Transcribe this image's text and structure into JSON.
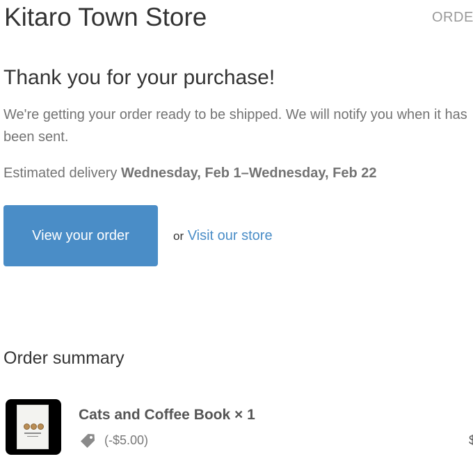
{
  "header": {
    "store_name": "Kitaro Town Store",
    "order_link": "ORDER"
  },
  "confirmation": {
    "heading": "Thank you for your purchase!",
    "message": "We're getting your order ready to be shipped. We will notify you when it has been sent.",
    "delivery_label": "Estimated delivery",
    "delivery_dates": "Wednesday, Feb 1–Wednesday, Feb 22"
  },
  "actions": {
    "view_order_label": "View your order",
    "or_text": "or",
    "visit_store_label": "Visit our store"
  },
  "summary": {
    "heading": "Order summary",
    "items": [
      {
        "name": "Cats and Coffee Book × 1",
        "discount": "(-$5.00)",
        "price_visible": "$",
        "icon": "tag-icon"
      }
    ]
  },
  "colors": {
    "accent": "#4a8dc7",
    "text": "#333333",
    "muted": "#737373"
  }
}
